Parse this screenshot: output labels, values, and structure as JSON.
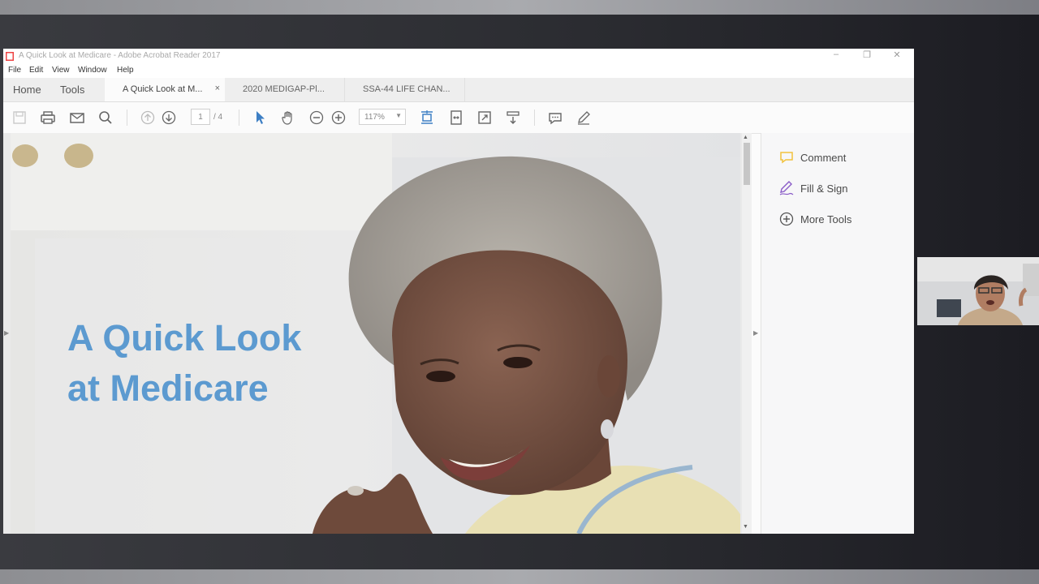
{
  "window": {
    "title": "A Quick Look at Medicare - Adobe Acrobat Reader 2017",
    "controls": {
      "minimize": "–",
      "restore": "❐",
      "close": "✕"
    }
  },
  "menu": [
    "File",
    "Edit",
    "View",
    "Window",
    "Help"
  ],
  "tabs": {
    "home": "Home",
    "tools": "Tools",
    "documents": [
      {
        "label": "A Quick Look at M...",
        "active": true,
        "close": "×"
      },
      {
        "label": "2020 MEDIGAP-Pl...",
        "active": false
      },
      {
        "label": "SSA-44 LIFE CHAN...",
        "active": false
      }
    ]
  },
  "toolbar": {
    "icons": [
      "save-icon",
      "print-icon",
      "email-icon",
      "search-icon",
      "page-up-icon",
      "page-down-icon",
      "select-arrow-icon",
      "hand-icon",
      "zoom-out-icon",
      "zoom-in-icon",
      "fit-page-icon",
      "fit-width-icon",
      "full-screen-icon",
      "scroll-mode-icon",
      "comment-icon",
      "sign-icon"
    ],
    "current_page": "1",
    "total_pages": "/ 4",
    "zoom": "117%",
    "zoom_arrow": "▼",
    "accent_color": "#3d7fc4"
  },
  "document": {
    "headline_line1": "A Quick Look",
    "headline_line2": "at Medicare",
    "headline_color": "#5c9ad0",
    "scroll_up": "▲",
    "scroll_down": "▼",
    "collapse_left": "◀",
    "collapse_right": "▶"
  },
  "right_pane": {
    "items": [
      {
        "label": "Comment",
        "icon": "comment-bubble-icon",
        "color": "#f2c23e"
      },
      {
        "label": "Fill & Sign",
        "icon": "fill-sign-pen-icon",
        "color": "#8a5cc8"
      },
      {
        "label": "More Tools",
        "icon": "plus-circle-icon",
        "color": "#555555"
      }
    ]
  }
}
